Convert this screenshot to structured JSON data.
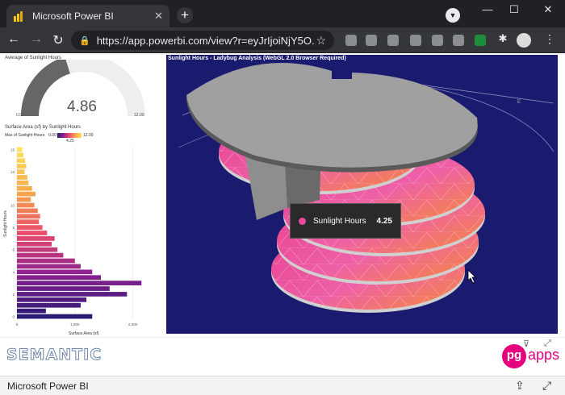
{
  "browser": {
    "tab_title": "Microsoft Power BI",
    "new_tab": "+",
    "url": "https://app.powerbi.com/view?r=eyJrIjoiNjY5O...",
    "window": {
      "minimize": "—",
      "maximize": "☐",
      "close": "✕"
    }
  },
  "gauge": {
    "title": "Average of Sunlight Hours",
    "value": "4.86",
    "min": "0.00",
    "max": "12.00",
    "fill_fraction": 0.405
  },
  "bar_chart": {
    "title": "Surface Area (sf) by Sunlight Hours",
    "legend_label": "Max of Sunlight Hours",
    "legend_min": "0.00",
    "legend_max": "12.00",
    "legend_marker": "4.25",
    "ylabel": "Sunlight Hours",
    "xlabel": "Surface Area (sf)",
    "xticks": [
      "0",
      "1,000",
      "2,000"
    ],
    "yticks": [
      "15",
      "13",
      "10",
      "8",
      "6",
      "4",
      "2",
      "0"
    ]
  },
  "chart_data": {
    "type": "bar",
    "orientation": "horizontal",
    "xlabel": "Surface Area (sf)",
    "ylabel": "Sunlight Hours",
    "xlim": [
      0,
      2300
    ],
    "categories": [
      15,
      14.5,
      14,
      13.5,
      13,
      12.5,
      12,
      11.5,
      11,
      10.5,
      10,
      9.5,
      9,
      8.5,
      8,
      7.5,
      7,
      6.5,
      6,
      5.5,
      5,
      4.5,
      4,
      3.5,
      3,
      2.5,
      2,
      1.5,
      1,
      0.5,
      0
    ],
    "values": [
      90,
      110,
      140,
      160,
      130,
      180,
      200,
      260,
      320,
      240,
      300,
      360,
      400,
      380,
      440,
      520,
      650,
      600,
      700,
      800,
      1000,
      1100,
      1300,
      1450,
      2150,
      1600,
      1900,
      1200,
      1100,
      500,
      1300
    ]
  },
  "viz3d": {
    "title": "Sunlight Hours - Ladybug Analysis (WebGL 2.0 Browser Required)",
    "tooltip_label": "Sunlight Hours",
    "tooltip_value": "4.25"
  },
  "footer": {
    "logo_text": "SEMANTIC",
    "pg_text": "pg",
    "apps_text": "apps"
  },
  "bottombar": {
    "title": "Microsoft Power BI"
  }
}
